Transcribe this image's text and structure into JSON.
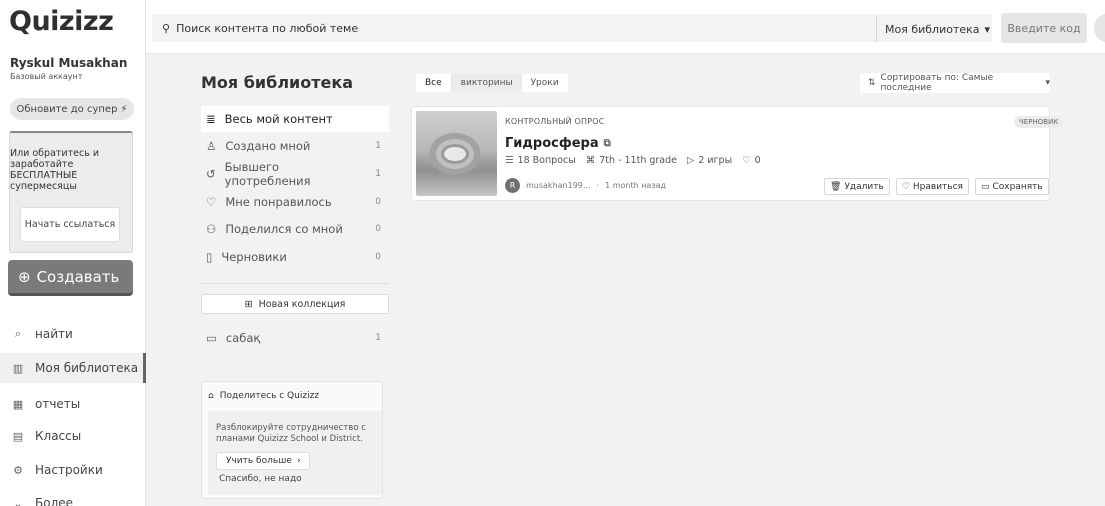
{
  "app": {
    "logo": "Quizizz"
  },
  "user": {
    "name": "Ryskul Musakhan",
    "account_type": "Базовый аккаунт"
  },
  "sidebar": {
    "upgrade_label": "Обновите до супер",
    "upgrade_icon": "⚡",
    "referral_text": "Или обратитесь и заработайте БЕСПЛАТНЫЕ супермесяцы",
    "referral_button": "Начать ссылаться",
    "create_label": "Создавать",
    "nav": [
      {
        "label": "найти",
        "icon": "⌕"
      },
      {
        "label": "Моя библиотека",
        "icon": "▥"
      },
      {
        "label": "отчеты",
        "icon": "▦"
      },
      {
        "label": "Классы",
        "icon": "▤"
      },
      {
        "label": "Настройки",
        "icon": "⚙"
      },
      {
        "label": "Более",
        "icon": "⌄"
      }
    ]
  },
  "topbar": {
    "search_placeholder": "Поиск контента по любой теме",
    "library_dropdown": "Моя библиотека",
    "code_placeholder": "Введите код"
  },
  "library": {
    "title": "Моя библиотека",
    "items": [
      {
        "label": "Весь мой контент",
        "count": ""
      },
      {
        "label": "Создано мной",
        "count": "1"
      },
      {
        "label": "Бывшего употребления",
        "count": "1"
      },
      {
        "label": "Мне понравилось",
        "count": "0"
      },
      {
        "label": "Поделился со мной",
        "count": "0"
      },
      {
        "label": "Черновики",
        "count": "0"
      }
    ],
    "new_collection": "Новая коллекция",
    "collections": [
      {
        "label": "сабақ",
        "count": "1"
      }
    ]
  },
  "share": {
    "title": "Поделитесь с Quizizz",
    "text": "Разблокируйте сотрудничество с планами Quizizz School и District.",
    "learn_more": "Учить больше",
    "no_thanks": "Спасибо, не надо"
  },
  "filters": {
    "tabs": [
      "Все",
      "викторины",
      "Уроки"
    ],
    "sort_label": "Сортировать по: Самые последние"
  },
  "quiz": {
    "type": "КОНТРОЛЬНЫЙ ОПРОС",
    "badge": "ЧЕРНОВИК",
    "title": "Гидросфера",
    "questions": "18 Вопросы",
    "grade": "7th - 11th grade",
    "games": "2 игры",
    "likes": "0",
    "author_initial": "R",
    "author": "musakhan199...",
    "time": "1 month назад",
    "actions": {
      "delete": "Удалить",
      "like": "Нравиться",
      "save": "Сохранять"
    }
  }
}
